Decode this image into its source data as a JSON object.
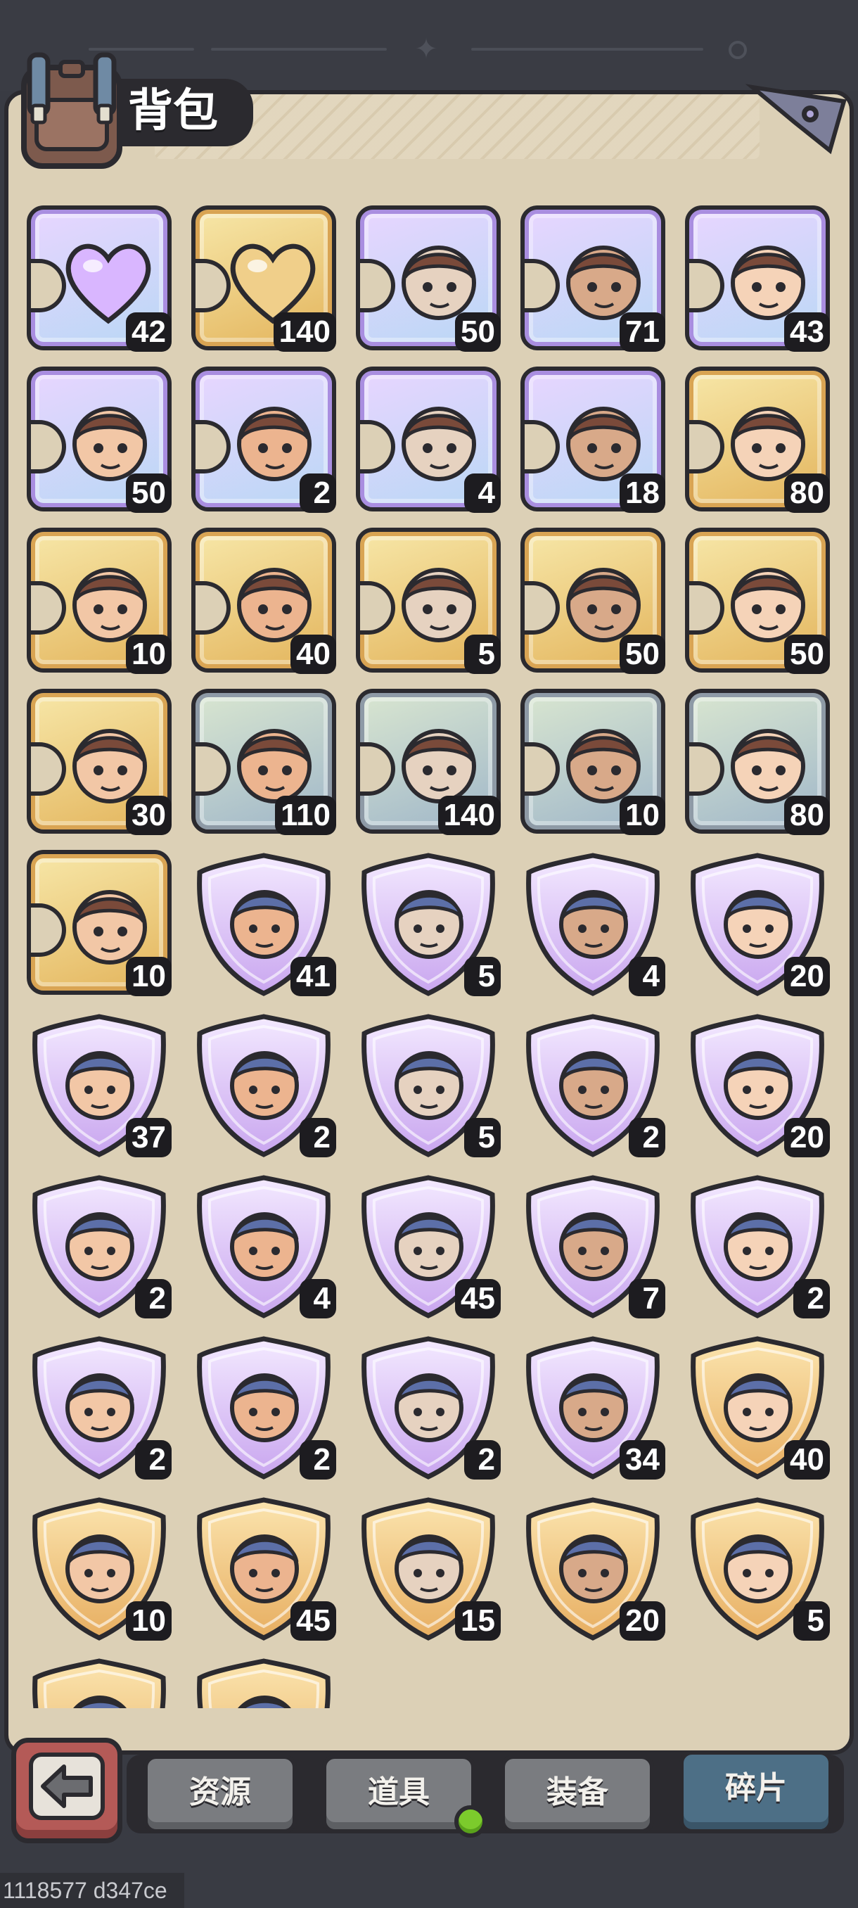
{
  "header": {
    "title": "背包"
  },
  "items": [
    {
      "type": "puzzle",
      "rarity": "purple",
      "icon": "purple-heart-shard-icon",
      "count": "42"
    },
    {
      "type": "puzzle",
      "rarity": "gold",
      "icon": "gold-heart-shard-icon",
      "count": "140"
    },
    {
      "type": "puzzle",
      "rarity": "purple",
      "icon": "red-hair-princess-shard-icon",
      "count": "50"
    },
    {
      "type": "puzzle",
      "rarity": "purple",
      "icon": "tiger-warrior-shard-icon",
      "count": "71"
    },
    {
      "type": "puzzle",
      "rarity": "purple",
      "icon": "bull-demon-shard-icon",
      "count": "43"
    },
    {
      "type": "puzzle",
      "rarity": "purple",
      "icon": "teal-priestess-shard-icon",
      "count": "50"
    },
    {
      "type": "puzzle",
      "rarity": "purple",
      "icon": "green-hair-sage-shard-icon",
      "count": "2"
    },
    {
      "type": "puzzle",
      "rarity": "purple",
      "icon": "blue-hair-rogue-shard-icon",
      "count": "4"
    },
    {
      "type": "puzzle",
      "rarity": "purple",
      "icon": "blue-elf-ranger-shard-icon",
      "count": "18"
    },
    {
      "type": "puzzle",
      "rarity": "gold",
      "icon": "red-hair-monocle-lady-shard-icon",
      "count": "80"
    },
    {
      "type": "puzzle",
      "rarity": "gold",
      "icon": "golden-knight-shard-icon",
      "count": "10"
    },
    {
      "type": "puzzle",
      "rarity": "gold",
      "icon": "orange-hair-girl-shard-icon",
      "count": "40"
    },
    {
      "type": "puzzle",
      "rarity": "gold",
      "icon": "green-hair-brawler-shard-icon",
      "count": "5"
    },
    {
      "type": "puzzle",
      "rarity": "gold",
      "icon": "dreadlock-warrior-shard-icon",
      "count": "50"
    },
    {
      "type": "puzzle",
      "rarity": "gold",
      "icon": "pink-hair-engineer-shard-icon",
      "count": "50"
    },
    {
      "type": "puzzle",
      "rarity": "gold",
      "icon": "bearded-king-shard-icon",
      "count": "30"
    },
    {
      "type": "puzzle",
      "rarity": "silver",
      "icon": "bearded-soldier-shard-icon",
      "count": "110"
    },
    {
      "type": "puzzle",
      "rarity": "silver",
      "icon": "masked-beast-shard-icon",
      "count": "140"
    },
    {
      "type": "puzzle",
      "rarity": "silver",
      "icon": "blue-dragon-shard-icon",
      "count": "10"
    },
    {
      "type": "puzzle",
      "rarity": "silver",
      "icon": "black-hair-swordsman-shard-icon",
      "count": "80"
    },
    {
      "type": "puzzle",
      "rarity": "gold",
      "icon": "white-hair-mage-shard-icon",
      "count": "10"
    },
    {
      "type": "shield",
      "rarity": "purple",
      "icon": "red-hair-princess-icon",
      "count": "41"
    },
    {
      "type": "shield",
      "rarity": "purple",
      "icon": "tiger-warrior-icon",
      "count": "5"
    },
    {
      "type": "shield",
      "rarity": "purple",
      "icon": "blonde-knight-icon",
      "count": "4"
    },
    {
      "type": "shield",
      "rarity": "purple",
      "icon": "bull-demon-icon",
      "count": "20"
    },
    {
      "type": "shield",
      "rarity": "purple",
      "icon": "green-elf-icon",
      "count": "37"
    },
    {
      "type": "shield",
      "rarity": "purple",
      "icon": "crowned-prince-icon",
      "count": "2"
    },
    {
      "type": "shield",
      "rarity": "purple",
      "icon": "blue-hair-elf-icon",
      "count": "5"
    },
    {
      "type": "shield",
      "rarity": "purple",
      "icon": "scarred-warrior-icon",
      "count": "2"
    },
    {
      "type": "shield",
      "rarity": "purple",
      "icon": "teal-priestess-icon",
      "count": "20"
    },
    {
      "type": "shield",
      "rarity": "purple",
      "icon": "masked-dancer-icon",
      "count": "2"
    },
    {
      "type": "shield",
      "rarity": "purple",
      "icon": "purple-hair-monk-icon",
      "count": "4"
    },
    {
      "type": "shield",
      "rarity": "purple",
      "icon": "shark-icon",
      "count": "45"
    },
    {
      "type": "shield",
      "rarity": "purple",
      "icon": "goggles-pilot-icon",
      "count": "7"
    },
    {
      "type": "shield",
      "rarity": "purple",
      "icon": "green-hair-sage-icon",
      "count": "2"
    },
    {
      "type": "shield",
      "rarity": "purple",
      "icon": "blue-hair-rogue-icon",
      "count": "2"
    },
    {
      "type": "shield",
      "rarity": "purple",
      "icon": "goggles-kid-icon",
      "count": "2"
    },
    {
      "type": "shield",
      "rarity": "purple",
      "icon": "blonde-girl-icon",
      "count": "2"
    },
    {
      "type": "shield",
      "rarity": "purple",
      "icon": "blue-elf-ranger-icon",
      "count": "34"
    },
    {
      "type": "shield",
      "rarity": "gold",
      "icon": "red-hair-monocle-lady-icon",
      "count": "40"
    },
    {
      "type": "shield",
      "rarity": "gold",
      "icon": "golden-knight-icon",
      "count": "10"
    },
    {
      "type": "shield",
      "rarity": "gold",
      "icon": "wooden-mask-icon",
      "count": "45"
    },
    {
      "type": "shield",
      "rarity": "gold",
      "icon": "green-hair-brawler-icon",
      "count": "15"
    },
    {
      "type": "shield",
      "rarity": "gold",
      "icon": "dreadlock-warrior-icon",
      "count": "20"
    },
    {
      "type": "shield",
      "rarity": "gold",
      "icon": "pink-hair-engineer-icon",
      "count": "5"
    },
    {
      "type": "shield",
      "rarity": "gold",
      "icon": "white-hair-elf-icon",
      "count": ""
    },
    {
      "type": "shield",
      "rarity": "gold",
      "icon": "turban-merchant-icon",
      "count": ""
    }
  ],
  "tabs": [
    {
      "label": "资源",
      "active": false
    },
    {
      "label": "道具",
      "active": false
    },
    {
      "label": "装备",
      "active": false
    },
    {
      "label": "碎片",
      "active": true
    }
  ],
  "colors": {
    "purple_bg_a": "#e8d6ff",
    "purple_bg_b": "#b9d7f5",
    "gold_bg_a": "#f7e7a8",
    "gold_bg_b": "#e3b45c",
    "silver_bg_a": "#d9e6d0",
    "silver_bg_b": "#9fb6c9",
    "active_tab": "#4d6f86",
    "notification_dot": "#7ccb2c"
  },
  "footer": {
    "id_text": "1118577 d347ce"
  }
}
